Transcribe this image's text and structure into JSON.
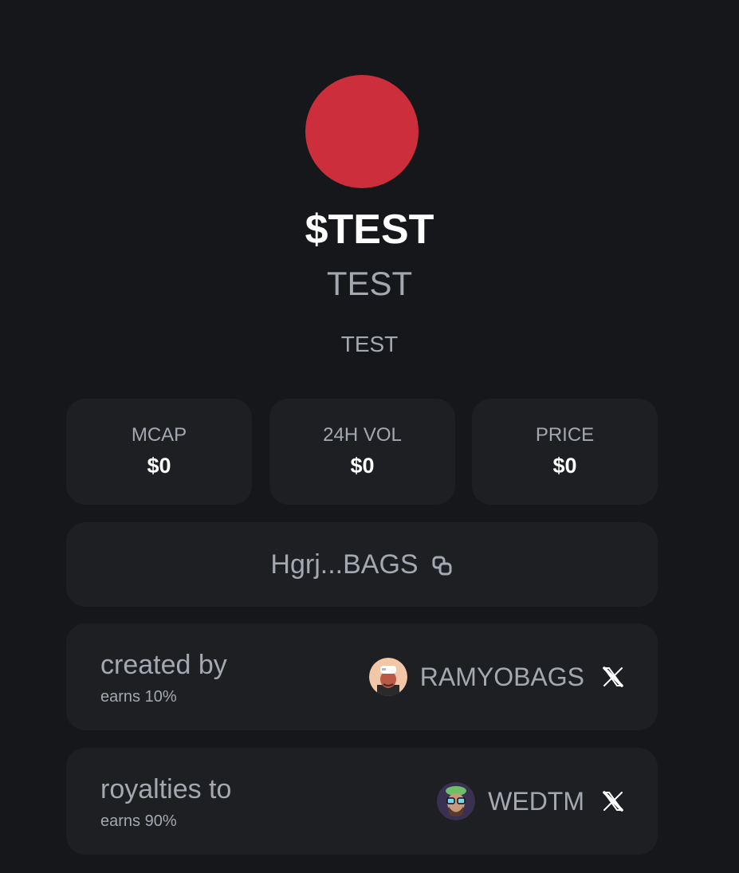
{
  "token": {
    "logo_color": "#cc2f3b",
    "ticker": "$TEST",
    "name": "TEST",
    "description": "TEST"
  },
  "stats": [
    {
      "label": "MCAP",
      "value": "$0"
    },
    {
      "label": "24H VOL",
      "value": "$0"
    },
    {
      "label": "PRICE",
      "value": "$0"
    }
  ],
  "contract": {
    "address_short": "Hgrj...BAGS",
    "copy_icon": "copy-icon"
  },
  "creator": {
    "title": "created by",
    "earnings": "earns 10%",
    "handle": "RAMYOBAGS",
    "social_icon": "x-logo-icon"
  },
  "royalties": {
    "title": "royalties to",
    "earnings": "earns 90%",
    "handle": "WEDTM",
    "social_icon": "x-logo-icon"
  },
  "colors": {
    "background": "#15171a",
    "card": "#1e1f23",
    "muted_text": "#a4a8b0",
    "accent": "#cc2f3b"
  }
}
